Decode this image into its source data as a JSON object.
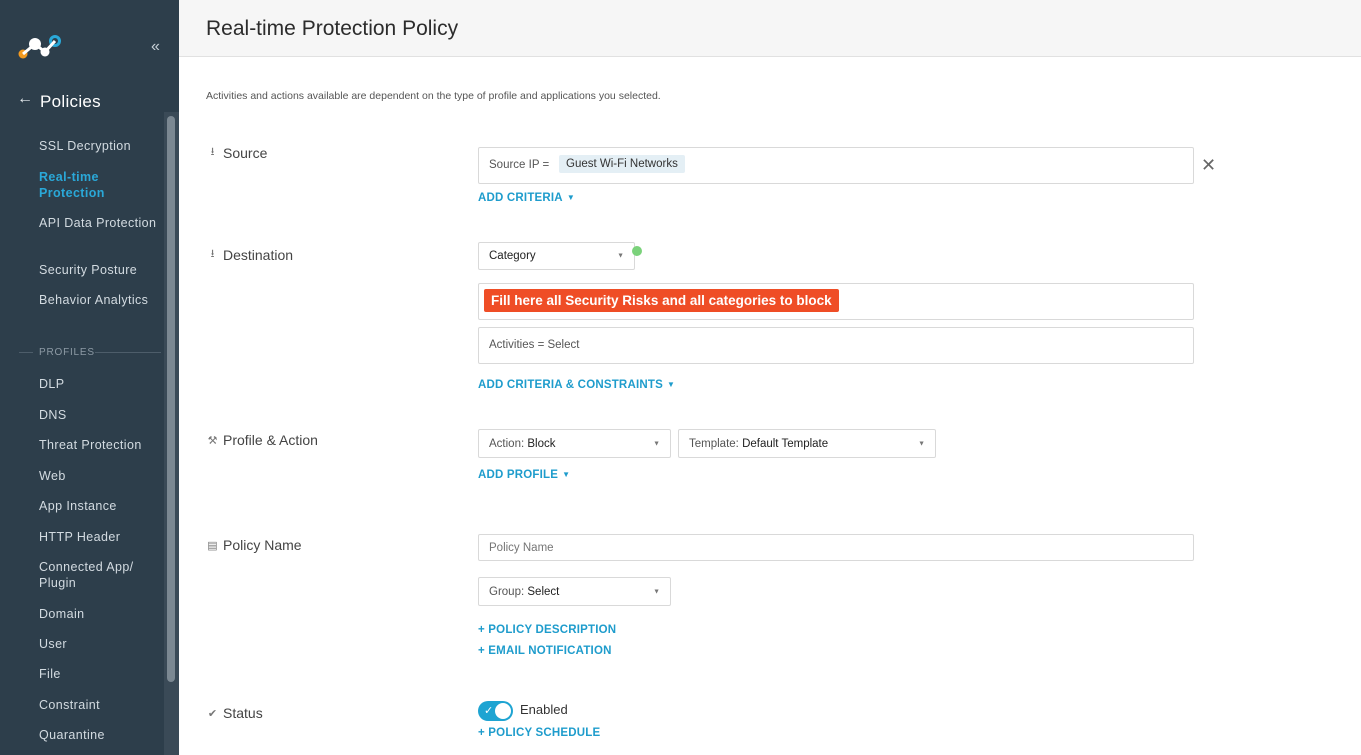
{
  "sidebar": {
    "title": "Policies",
    "items": [
      {
        "label": "SSL Decryption"
      },
      {
        "label": "Real-time Protection"
      },
      {
        "label": "API Data Protection"
      },
      {
        "label": "Security Posture"
      },
      {
        "label": "Behavior Analytics"
      }
    ],
    "profiles_header": "PROFILES",
    "profiles": [
      {
        "label": "DLP"
      },
      {
        "label": "DNS"
      },
      {
        "label": "Threat Protection"
      },
      {
        "label": "Web"
      },
      {
        "label": "App Instance"
      },
      {
        "label": "HTTP Header"
      },
      {
        "label": "Connected App/ Plugin"
      },
      {
        "label": "Domain"
      },
      {
        "label": "User"
      },
      {
        "label": "File"
      },
      {
        "label": "Constraint"
      },
      {
        "label": "Quarantine"
      }
    ]
  },
  "header": {
    "title": "Real-time Protection Policy"
  },
  "subtitle": "Activities and actions available are dependent on the type of profile and applications you selected.",
  "source": {
    "label": "Source",
    "criteria_prefix": "Source IP =",
    "criteria_value": "Guest Wi-Fi Networks",
    "add_criteria": "ADD CRITERIA"
  },
  "destination": {
    "label": "Destination",
    "category_select": "Category",
    "annotation": "Fill here all Security Risks and all categories to block",
    "activities": "Activities = Select",
    "add_criteria": "ADD CRITERIA & CONSTRAINTS"
  },
  "profile_action": {
    "label": "Profile & Action",
    "action_prefix": "Action:",
    "action_value": "Block",
    "template_prefix": "Template:",
    "template_value": "Default Template",
    "add_profile": "ADD PROFILE"
  },
  "policy_name": {
    "label": "Policy Name",
    "placeholder": "Policy Name",
    "group_prefix": "Group:",
    "group_value": "Select",
    "policy_description": "+ POLICY DESCRIPTION",
    "email_notification": "+ EMAIL NOTIFICATION"
  },
  "status": {
    "label": "Status",
    "toggle_label": "Enabled",
    "policy_schedule": "+ POLICY SCHEDULE"
  },
  "colors": {
    "sidebar_bg": "#2d3e4b",
    "accent": "#1e9ccc",
    "annotation": "#ef4d26",
    "toggle_on": "#1ea4d2"
  }
}
